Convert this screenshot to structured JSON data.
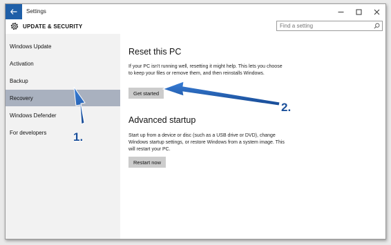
{
  "window": {
    "title": "Settings"
  },
  "header": {
    "section_title": "UPDATE & SECURITY"
  },
  "search": {
    "placeholder": "Find a setting"
  },
  "sidebar": {
    "items": [
      {
        "label": "Windows Update"
      },
      {
        "label": "Activation"
      },
      {
        "label": "Backup"
      },
      {
        "label": "Recovery",
        "active": true
      },
      {
        "label": "Windows Defender"
      },
      {
        "label": "For developers"
      }
    ]
  },
  "main": {
    "reset": {
      "title": "Reset this PC",
      "description": "If your PC isn't running well, resetting it might help. This lets you choose to keep your files or remove them, and then reinstalls Windows.",
      "button": "Get started"
    },
    "advanced": {
      "title": "Advanced startup",
      "description": "Start up from a device or disc (such as a USB drive or DVD), change Windows startup settings, or restore Windows from a system image. This will restart your PC.",
      "button": "Restart now"
    }
  },
  "annotations": {
    "step1": "1.",
    "step2": "2."
  },
  "colors": {
    "accent": "#1f5fa8",
    "active_item": "#a9b1bf",
    "sidebar_bg": "#f2f2f2",
    "button_bg": "#cccccc",
    "arrow": "#1a5bb5"
  },
  "icons": [
    "back-arrow-icon",
    "minimize-icon",
    "maximize-icon",
    "close-icon",
    "gear-icon",
    "search-icon"
  ]
}
